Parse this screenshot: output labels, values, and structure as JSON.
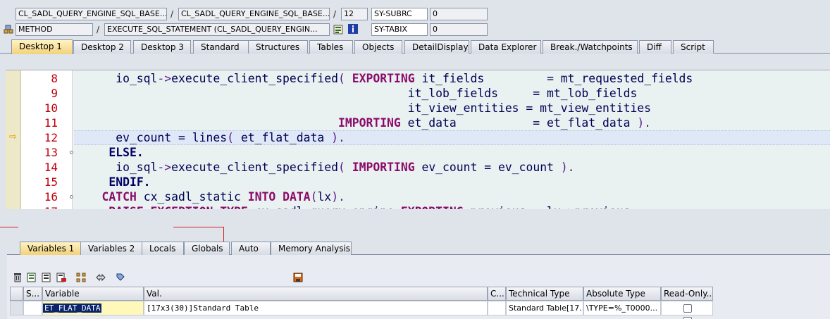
{
  "header": {
    "row1": {
      "program": "CL_SADL_QUERY_ENGINE_SQL_BASE...",
      "include": "CL_SADL_QUERY_ENGINE_SQL_BASE...",
      "line": "12",
      "sysvar_name": "SY-SUBRC",
      "sysvar_value": "0",
      "sep1": "/",
      "sep2": "/"
    },
    "row2": {
      "event_type": "METHOD",
      "event": "EXECUTE_SQL_STATEMENT (CL_SADL_QUERY_ENGIN...",
      "sysvar_name": "SY-TABIX",
      "sysvar_value": "0",
      "sep1": "/"
    }
  },
  "tabs": [
    "Desktop 1",
    "Desktop 2",
    "Desktop 3",
    "Standard",
    "Structures",
    "Tables",
    "Objects",
    "DetailDisplay",
    "Data Explorer",
    "Break./Watchpoints",
    "Diff",
    "Script"
  ],
  "code": {
    "lines": [
      {
        "no": "8",
        "parts": [
          [
            "",
            "      io_sql"
          ],
          [
            "pu",
            "->"
          ],
          [
            "",
            "execute_client_specified"
          ],
          [
            "pu",
            "( "
          ],
          [
            "kw",
            "EXPORTING"
          ],
          [
            "",
            " it_fields         = mt_requested_fields"
          ]
        ]
      },
      {
        "no": "9",
        "parts": [
          [
            "",
            "                                                it_lob_fields     = mt_lob_fields"
          ]
        ]
      },
      {
        "no": "10",
        "parts": [
          [
            "",
            "                                                it_view_entities = mt_view_entities"
          ]
        ]
      },
      {
        "no": "11",
        "parts": [
          [
            "",
            "                                      "
          ],
          [
            "kw",
            "IMPORTING"
          ],
          [
            "",
            " et_data           = et_flat_data "
          ],
          [
            "pu",
            ")."
          ]
        ]
      },
      {
        "no": "12",
        "parts": [
          [
            "",
            "      ev_count = lines"
          ],
          [
            "pu",
            "( "
          ],
          [
            "",
            "et_flat_data "
          ],
          [
            "pu",
            ")."
          ]
        ]
      },
      {
        "no": "13",
        "parts": [
          [
            "",
            "     "
          ],
          [
            "id",
            "ELSE."
          ]
        ]
      },
      {
        "no": "14",
        "parts": [
          [
            "",
            "      io_sql"
          ],
          [
            "pu",
            "->"
          ],
          [
            "",
            "execute_client_specified"
          ],
          [
            "pu",
            "( "
          ],
          [
            "kw",
            "IMPORTING"
          ],
          [
            "",
            " ev_count = ev_count "
          ],
          [
            "pu",
            ")."
          ]
        ]
      },
      {
        "no": "15",
        "parts": [
          [
            "",
            "     "
          ],
          [
            "id",
            "ENDIF."
          ]
        ]
      },
      {
        "no": "16",
        "parts": [
          [
            "",
            "    "
          ],
          [
            "kw",
            "CATCH"
          ],
          [
            "",
            " cx_sadl_static "
          ],
          [
            "kw",
            "INTO"
          ],
          [
            "",
            " "
          ],
          [
            "kw",
            "DATA"
          ],
          [
            "pu",
            "("
          ],
          [
            "",
            "lx"
          ],
          [
            "pu",
            ")."
          ]
        ]
      },
      {
        "no": "17",
        "parts": [
          [
            "",
            "     "
          ],
          [
            "kw",
            "RAISE EXCEPTION TYPE"
          ],
          [
            "",
            " cx_sadl_query_engine "
          ],
          [
            "kw",
            "EXPORTING"
          ],
          [
            "",
            " previous = lx->previous"
          ]
        ]
      }
    ]
  },
  "bottom_tabs": [
    "Variables 1",
    "Variables 2",
    "Locals",
    "Globals",
    "Auto",
    "Memory Analysis"
  ],
  "table": {
    "headers": [
      "S...",
      "Variable",
      "Val.",
      "C...",
      "Technical Type",
      "Absolute Type",
      "Read-Only..."
    ],
    "rows": [
      {
        "variable": "ET_FLAT_DATA",
        "value": "[17x3(30)]Standard Table",
        "c": "",
        "technical_type": "Standard Table[17...",
        "absolute_type": "\\TYPE=%_T0000..."
      }
    ]
  }
}
